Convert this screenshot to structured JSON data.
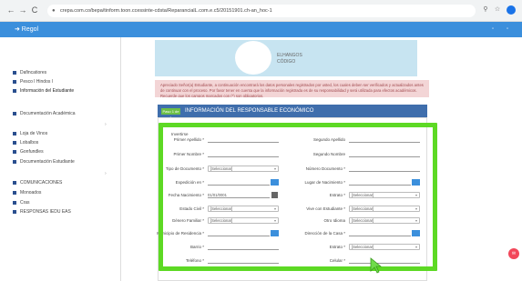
{
  "browser": {
    "back": "←",
    "forward": "→",
    "reload": "C",
    "url": "crepa.com.co/bepa/tinform.toon.ccessinte-cdsta/ReparancialL.com.e.c5/20151901.ch-an_hoc-1",
    "icons": [
      "search-icon",
      "star-icon",
      "profile-icon"
    ]
  },
  "topbar": {
    "back_label": "➜ Regol"
  },
  "sidebar": {
    "items": [
      {
        "label": "Dafincatiores"
      },
      {
        "label": "Pesco l Hindos l"
      },
      {
        "label": "Información del Estudiante"
      },
      {
        "label": "Documentación Académica"
      },
      {
        "label": "Loja de Vinos"
      },
      {
        "label": "Lobalbos"
      },
      {
        "label": "Gonfundles"
      },
      {
        "label": "Documentación Estudiante"
      },
      {
        "label": "COMUNICACIONES"
      },
      {
        "label": "Monoados"
      },
      {
        "label": "Cras"
      },
      {
        "label": "RESPONSAS IEDU EAS"
      }
    ]
  },
  "profile": {
    "name": "ELHANGOS",
    "code": "CÓDIGO"
  },
  "alert": {
    "text": "Apreciado Señor(a) Estudiante, a continuación encontrará los datos personales registrados por usted, los cuales deben ser verificados y actualizados antes de continuar con el proceso. Por favor tener en cuenta que la información registrada es de su responsabilidad y será utilizada para efectos académicos. Recuerde que los campos marcados con (*) son obligatorios."
  },
  "section": {
    "badge": "Paso 1 de 1",
    "title": "INFORMACIÓN DEL RESPONSABLE ECONÓMICO"
  },
  "form": {
    "heading": "Invertirse",
    "fields_left": [
      {
        "label": "Primer Apellido *",
        "type": "input",
        "value": ""
      },
      {
        "label": "Primer Nombre *",
        "type": "input",
        "value": ""
      },
      {
        "label": "Tipo de Documento *",
        "type": "select",
        "value": "[Seleccionar]"
      },
      {
        "label": "Expedición en *",
        "type": "input-btn",
        "value": ""
      },
      {
        "label": "Fecha Nacimiento *",
        "type": "date",
        "value": "01/01/0001"
      },
      {
        "label": "Estado Civil *",
        "type": "select",
        "value": "[Seleccionar]"
      },
      {
        "label": "Género Familiar *",
        "type": "select",
        "value": "[Seleccionar]"
      },
      {
        "label": "Municipio de Residencia *",
        "type": "input-btn",
        "value": ""
      },
      {
        "label": "Barrio *",
        "type": "input",
        "value": ""
      },
      {
        "label": "Teléfono *",
        "type": "input",
        "value": ""
      }
    ],
    "fields_right": [
      {
        "label": "Segundo Apellido",
        "type": "input",
        "value": ""
      },
      {
        "label": "Segundo Nombre",
        "type": "input",
        "value": ""
      },
      {
        "label": "Número Documento *",
        "type": "input",
        "value": ""
      },
      {
        "label": "Lugar de Nacimiento *",
        "type": "input-btn",
        "value": ""
      },
      {
        "label": "Estrato *",
        "type": "select",
        "value": "[Seleccionar]"
      },
      {
        "label": "Vive con Estudiante *",
        "type": "select",
        "value": "[Seleccionar]"
      },
      {
        "label": "Otro Idioma",
        "type": "select",
        "value": "[Seleccionar]"
      },
      {
        "label": "Dirección de la Casa *",
        "type": "input-btn",
        "value": ""
      },
      {
        "label": "Estrato *",
        "type": "select",
        "value": "[Seleccionar]"
      },
      {
        "label": "Celular *",
        "type": "input",
        "value": ""
      }
    ]
  },
  "fab": {
    "label": "✉"
  },
  "colors": {
    "topbar": "#3b8fdc",
    "panel_header": "#3f6eac",
    "highlight": "#5dd924",
    "alert_bg": "#f3d5d6",
    "hero_bg": "#c7e4f1"
  }
}
